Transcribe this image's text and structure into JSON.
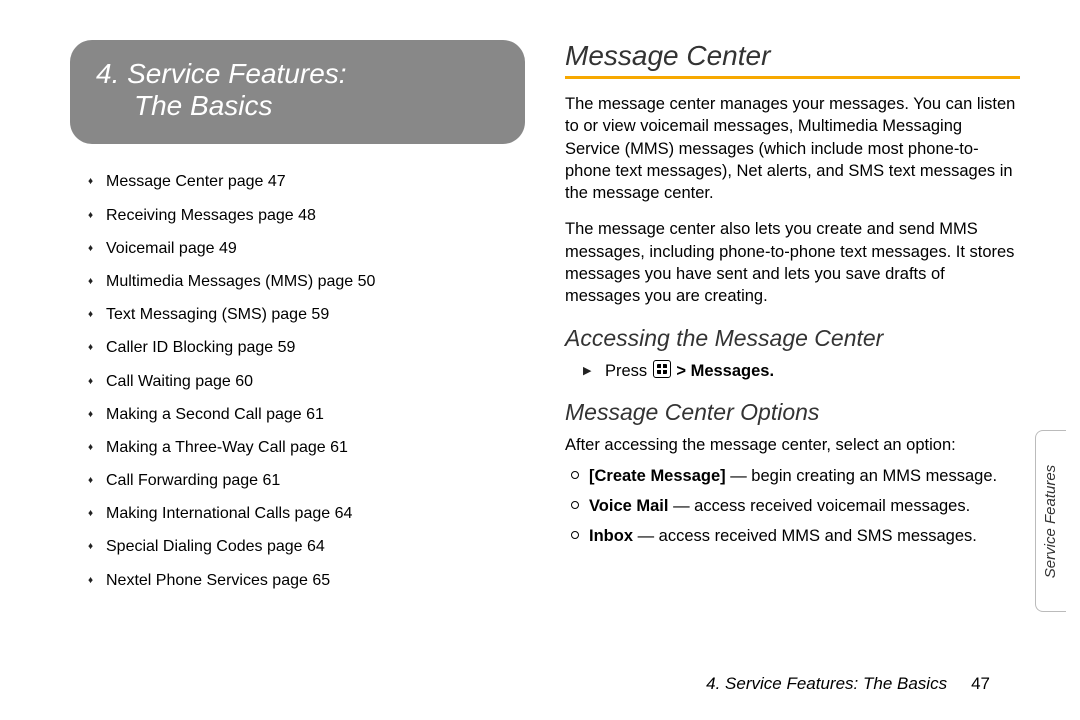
{
  "chapter": {
    "number_line": "4.   Service Features:",
    "subtitle": "The Basics"
  },
  "toc": [
    "Message Center page 47",
    "Receiving Messages page 48",
    "Voicemail page 49",
    "Multimedia Messages (MMS) page 50",
    "Text Messaging (SMS) page 59",
    "Caller ID Blocking page 59",
    "Call Waiting page 60",
    "Making a Second Call page 61",
    "Making a Three-Way Call page 61",
    "Call Forwarding page 61",
    "Making International Calls page 64",
    "Special Dialing Codes page 64",
    "Nextel Phone Services page 65"
  ],
  "right": {
    "h1": "Message Center",
    "p1": "The message center manages your messages. You can listen to or view voicemail messages, Multimedia Messaging Service (MMS) messages (which include most phone-to-phone text messages), Net alerts, and SMS text messages in the message center.",
    "p2": "The message center also lets you create and send MMS messages, including phone-to-phone text messages. It stores messages you have sent and lets you save drafts of messages you are creating.",
    "h2a": "Accessing the Message Center",
    "step_prefix": "Press ",
    "step_suffix_bold": " > Messages.",
    "h2b": "Message Center Options",
    "p3": "After accessing the message center, select an option:",
    "opts": [
      {
        "bold": "[Create Message]",
        "rest": " — begin creating an MMS message."
      },
      {
        "bold": "Voice Mail",
        "rest": " — access received voicemail messages."
      },
      {
        "bold": "Inbox",
        "rest": " — access received MMS and SMS messages."
      }
    ]
  },
  "footer": {
    "text": "4. Service Features: The Basics",
    "page": "47"
  },
  "side_tab": "Service Features"
}
